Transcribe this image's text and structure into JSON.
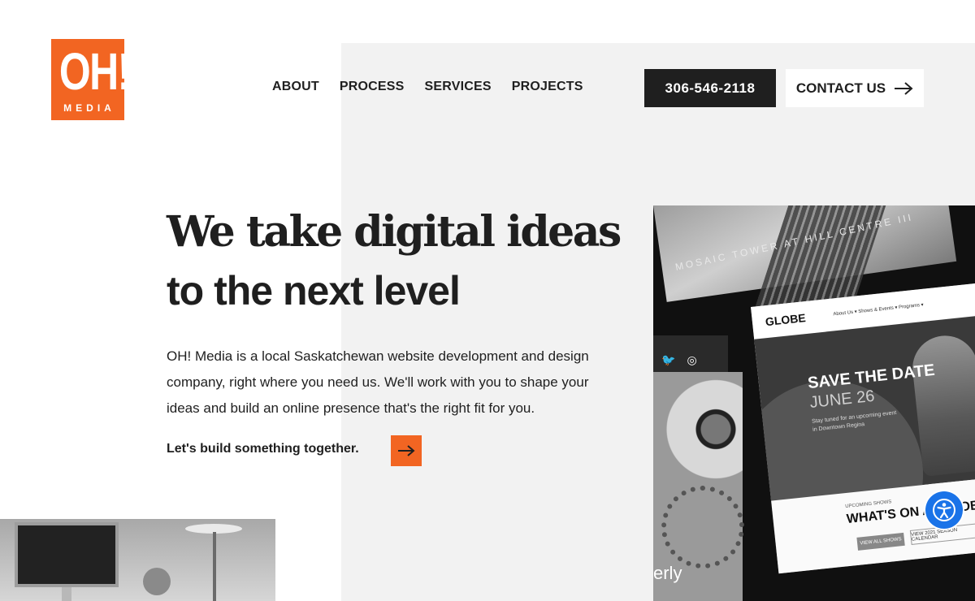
{
  "brand": {
    "logo_main": "OH!",
    "logo_sub": "MEDIA",
    "accent_color": "#f26522"
  },
  "nav": {
    "items": [
      {
        "label": "ABOUT"
      },
      {
        "label": "PROCESS"
      },
      {
        "label": "SERVICES"
      },
      {
        "label": "PROJECTS"
      }
    ]
  },
  "header": {
    "phone": "306-546-2118",
    "contact_label": "CONTACT US"
  },
  "hero": {
    "headline_line1": "We take digital ideas",
    "headline_line2": "to the next level",
    "intro": "OH! Media is a local Saskatchewan website development and design company, right where you need us. We'll work with you to shape your ideas and build an online presence that's the right fit for you.",
    "cta_text": "Let's build something together."
  },
  "collage": {
    "tower_caption": "MOSAIC TOWER AT HILL CENTRE III",
    "globe_logo": "GLOBE",
    "globe_menu": "About Us ▾    Shows & Events ▾    Programs ▾",
    "save_the_date": "SAVE THE DATE",
    "date": "JUNE 26",
    "stay_tuned": "Stay tuned for an upcoming event in Downtown Regina",
    "upcoming_label": "UPCOMING SHOWS",
    "whats_on": "WHAT'S ON AT GLOBE THEATRE",
    "view_all": "VIEW ALL SHOWS",
    "season_calendar": "VIEW 2021 SEASON CALENDAR",
    "fragment_word": "erly"
  },
  "accessibility": {
    "icon": "accessibility-icon",
    "color": "#1a73e8"
  }
}
